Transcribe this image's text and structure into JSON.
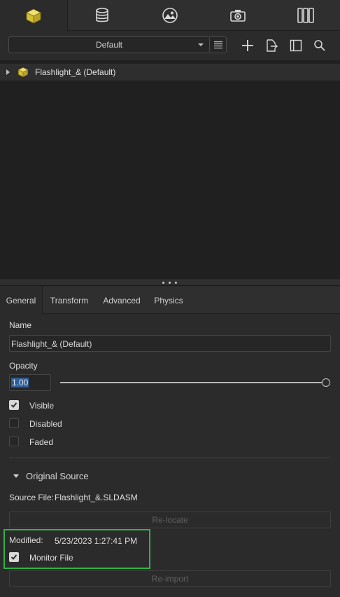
{
  "top_tabs": [
    {
      "icon": "cube-icon"
    },
    {
      "icon": "database-icon"
    },
    {
      "icon": "image-icon"
    },
    {
      "icon": "camera-icon"
    },
    {
      "icon": "columns-icon"
    }
  ],
  "toolbar": {
    "preset_value": "Default",
    "buttons": [
      "list-icon",
      "add-icon",
      "import-icon",
      "panel-icon",
      "search-icon"
    ]
  },
  "tree": {
    "items": [
      {
        "label": "Flashlight_& (Default)"
      }
    ]
  },
  "splitter": {
    "handle": "• • •"
  },
  "property_tabs": [
    {
      "label": "General",
      "active": true
    },
    {
      "label": "Transform",
      "active": false
    },
    {
      "label": "Advanced",
      "active": false
    },
    {
      "label": "Physics",
      "active": false
    }
  ],
  "general": {
    "name_label": "Name",
    "name_value": "Flashlight_& (Default)",
    "opacity_label": "Opacity",
    "opacity_value": "1.00",
    "opacity_fraction": 1.0,
    "checkboxes": [
      {
        "label": "Visible",
        "checked": true
      },
      {
        "label": "Disabled",
        "checked": false
      },
      {
        "label": "Faded",
        "checked": false
      }
    ]
  },
  "original_source": {
    "section_title": "Original Source",
    "source_file_label": "Source File:",
    "source_file_value": "Flashlight_&.SLDASM",
    "relocate_label": "Re-locate",
    "modified_label": "Modified:",
    "modified_value": "5/23/2023 1:27:41 PM",
    "monitor_label": "Monitor File",
    "monitor_checked": true,
    "reimport_label": "Re-import"
  },
  "colors": {
    "accent_cube": "#e8d44d",
    "highlight_box": "#2fb34a",
    "selection": "#2d5f9a"
  }
}
